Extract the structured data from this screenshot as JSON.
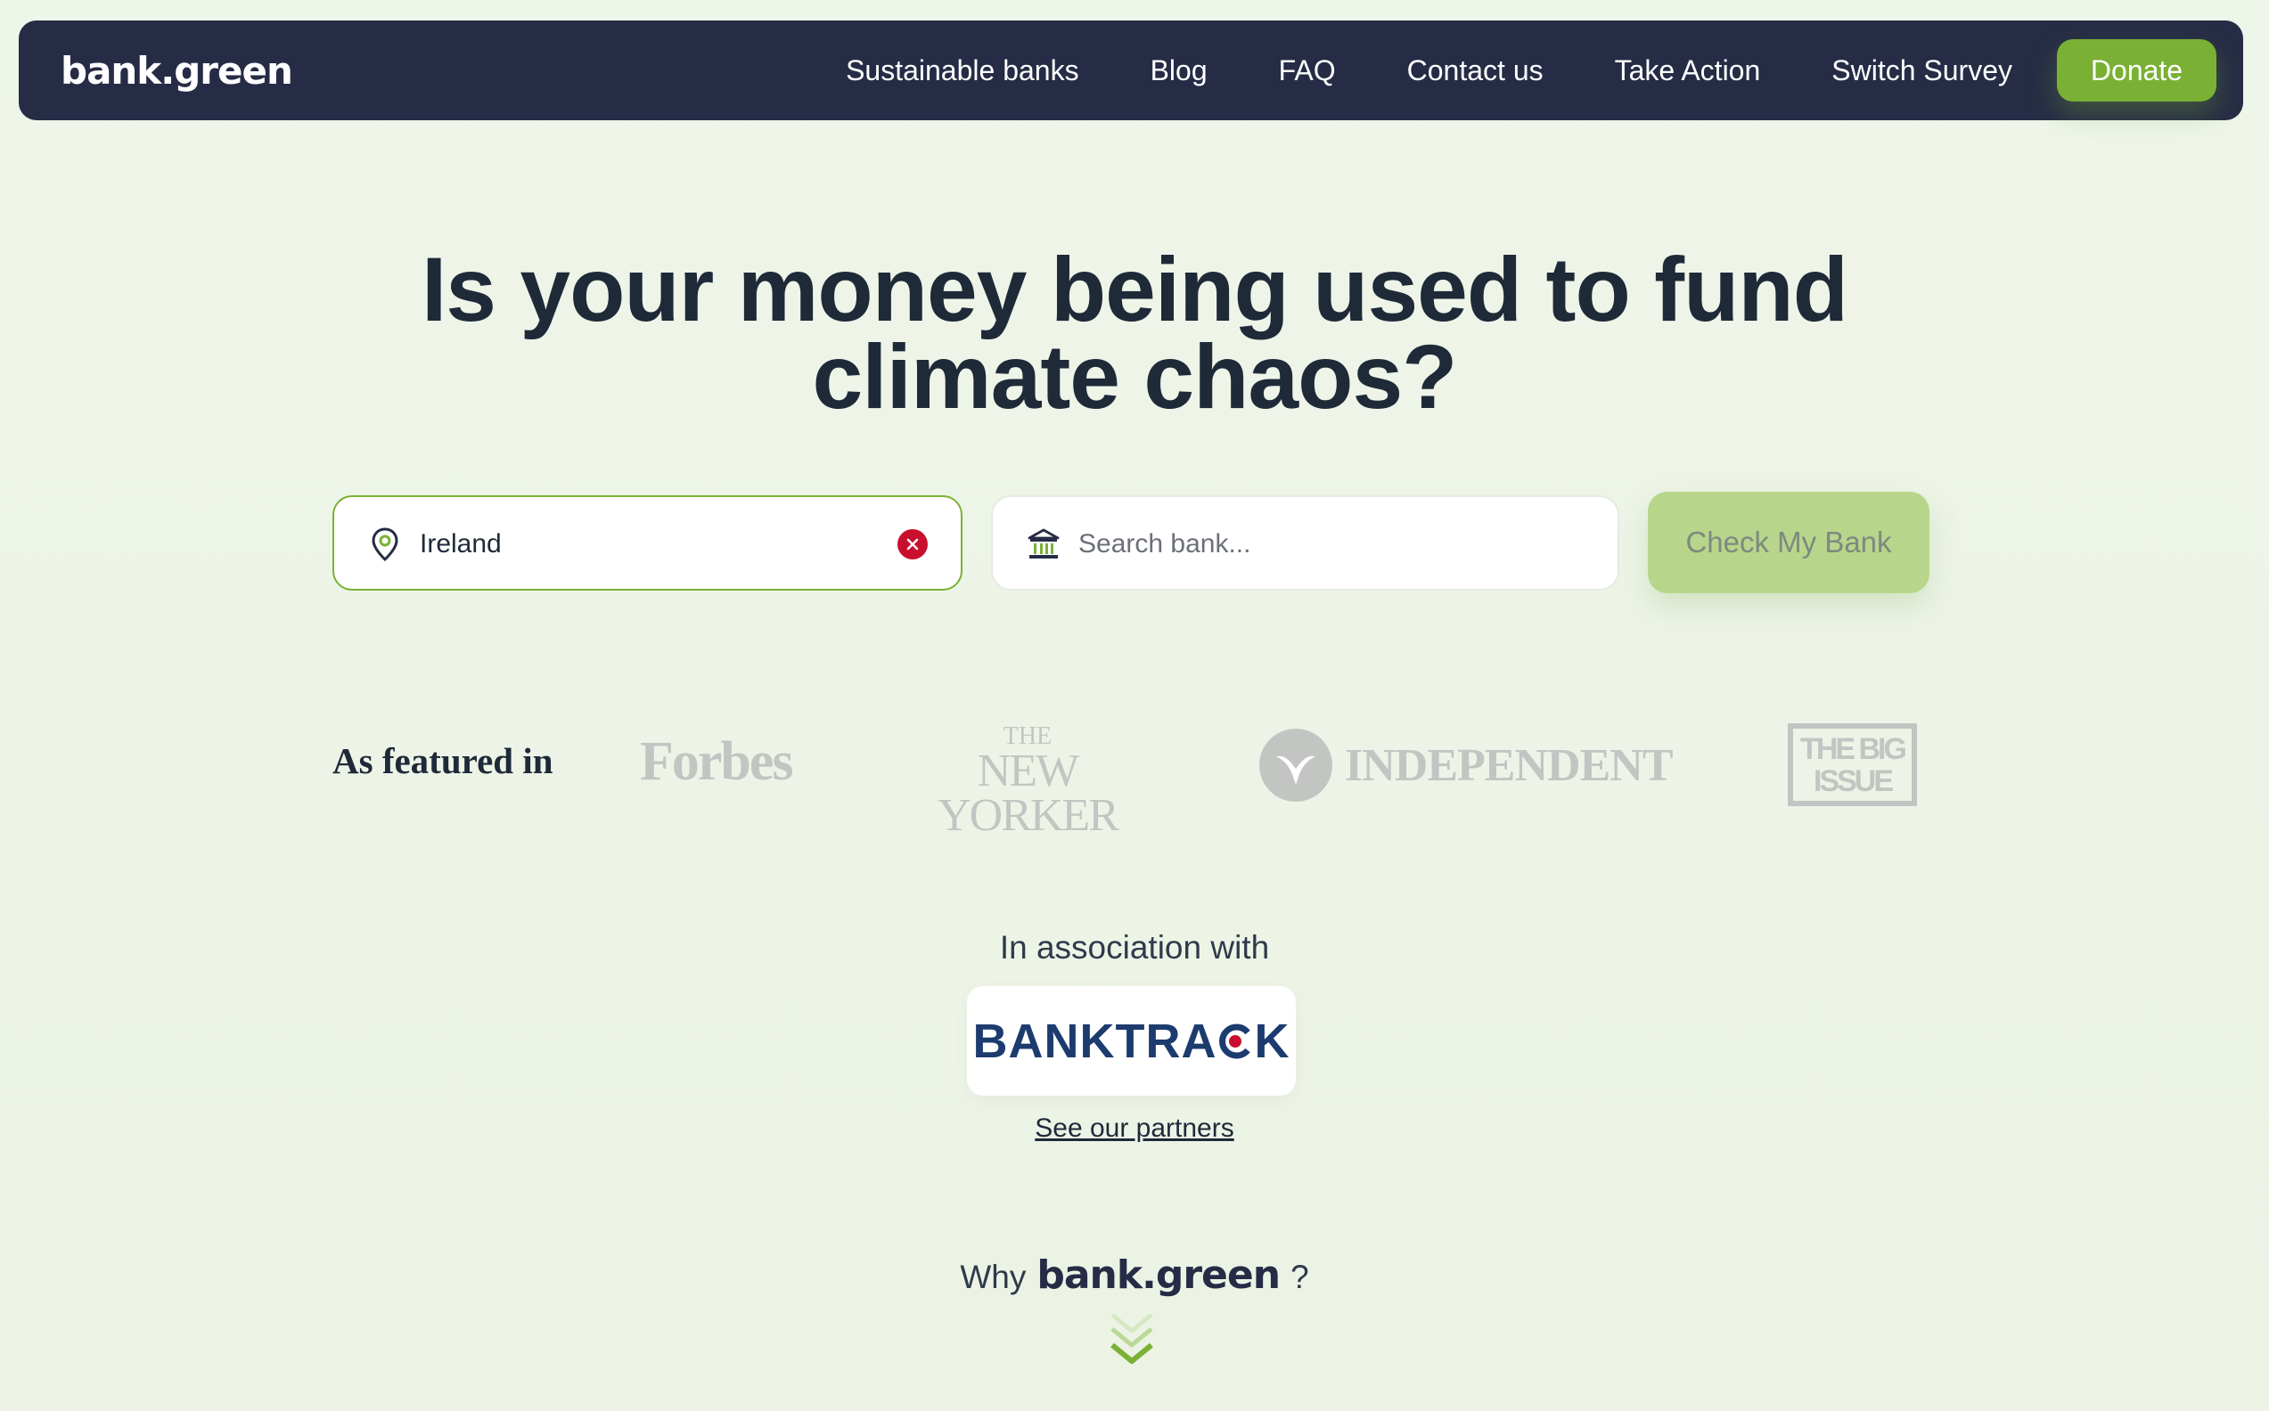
{
  "nav": {
    "logo": "bank.green",
    "links": [
      "Sustainable banks",
      "Blog",
      "FAQ",
      "Contact us",
      "Take Action",
      "Switch Survey"
    ],
    "donate_label": "Donate"
  },
  "hero": {
    "headline": "Is your money being used to fund climate chaos?"
  },
  "search": {
    "country_value": "Ireland",
    "country_icon": "location-pin-icon",
    "clear_icon": "close-icon",
    "bank_placeholder": "Search bank...",
    "bank_icon": "bank-building-icon",
    "submit_label": "Check My Bank"
  },
  "featured": {
    "label": "As featured in",
    "outlets": {
      "forbes": "Forbes",
      "newyorker_the": "THE",
      "newyorker_main": "NEW YORKER",
      "independent": "INDEPENDENT",
      "bigissue_line1": "THE BIG",
      "bigissue_line2": "ISSUE"
    }
  },
  "association": {
    "label": "In association with",
    "partner_left": "BANKTRA",
    "partner_right": "K",
    "partners_link": "See our partners"
  },
  "why": {
    "prefix": "Why",
    "logo": "bank.green",
    "suffix": "?"
  },
  "colors": {
    "nav_bg": "#262c45",
    "accent_green": "#7ab135",
    "button_disabled": "#b7d68b",
    "clear_red": "#c8102e",
    "banktrack_blue": "#1c3b6e",
    "page_bg": "#eef5e9"
  }
}
